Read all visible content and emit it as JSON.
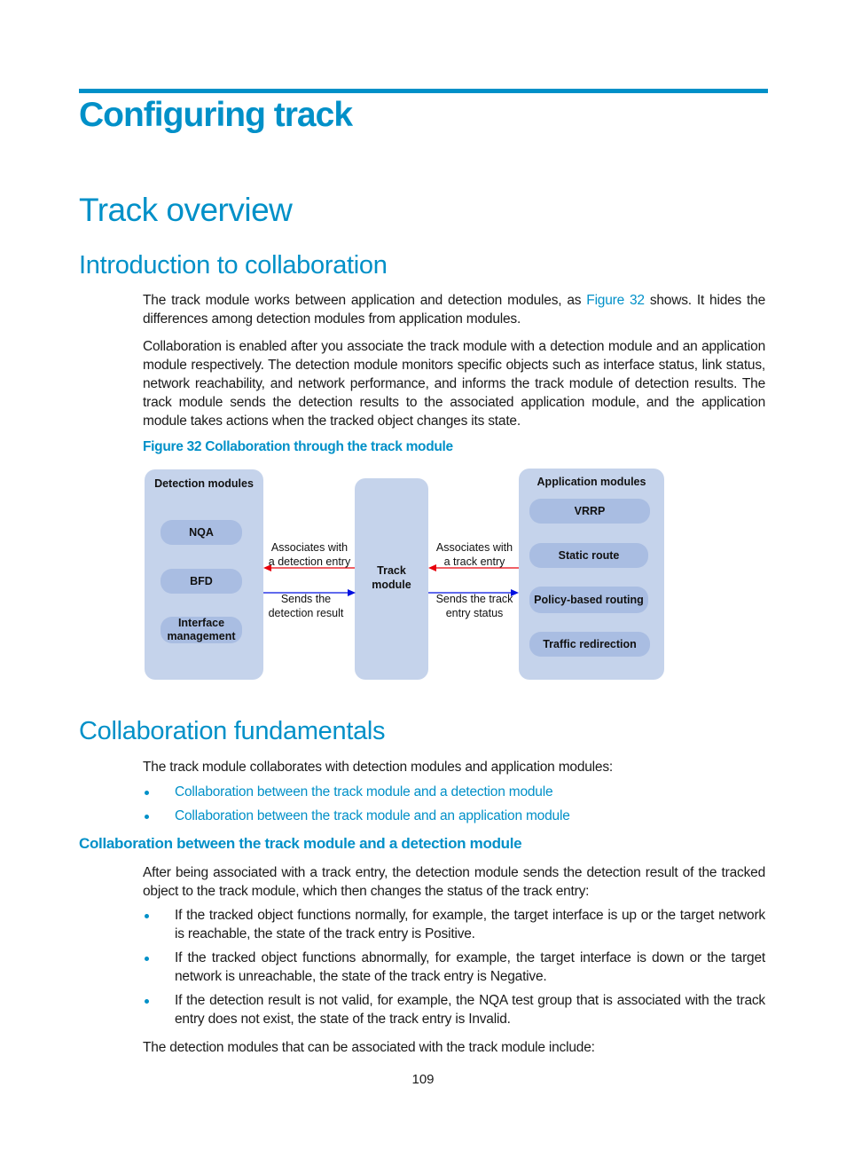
{
  "chapter_title": "Configuring track",
  "section_title": "Track overview",
  "intro": {
    "heading": "Introduction to collaboration",
    "para1_before": "The track module works between application and detection modules, as ",
    "para1_link": "Figure 32",
    "para1_after": " shows. It hides the differences among detection modules from application modules.",
    "para2": "Collaboration is enabled after you associate the track module with a detection module and an application module respectively. The detection module monitors specific objects such as interface status, link status, network reachability, and network performance, and informs the track module of detection results. The track module sends the detection results to the associated application module, and the application module takes actions when the tracked object changes its state."
  },
  "figure": {
    "caption": "Figure 32 Collaboration through the track module",
    "detection_panel": {
      "title": "Detection modules",
      "items": [
        "NQA",
        "BFD",
        "Interface management"
      ]
    },
    "track_panel": {
      "label_line1": "Track",
      "label_line2": "module"
    },
    "application_panel": {
      "title": "Application modules",
      "items": [
        "VRRP",
        "Static route",
        "Policy-based routing",
        "Traffic redirection"
      ]
    },
    "left_arrows": {
      "top_line1": "Associates with",
      "top_line2": "a detection entry",
      "bottom_line1": "Sends the",
      "bottom_line2": "detection result"
    },
    "right_arrows": {
      "top_line1": "Associates with",
      "top_line2": "a track entry",
      "bottom_line1": "Sends the track",
      "bottom_line2": "entry status"
    },
    "colors": {
      "request_arrow": "#e8000b",
      "response_arrow": "#0010e0",
      "panel": "#c5d3eb",
      "pill": "#a9bde2"
    }
  },
  "fundamentals": {
    "heading": "Collaboration fundamentals",
    "intro": "The track module collaborates with detection modules and application modules:",
    "links": [
      "Collaboration between the track module and a detection module",
      "Collaboration between the track module and an application module"
    ]
  },
  "detection_collab": {
    "heading": "Collaboration between the track module and a detection module",
    "intro": "After being associated with a track entry, the detection module sends the detection result of the tracked object to the track module, which then changes the status of the track entry:",
    "bullets": [
      "If the tracked object functions normally, for example, the target interface is up or the target network is reachable, the state of the track entry is Positive.",
      "If the tracked object functions abnormally, for example, the target interface is down or the target network is unreachable, the state of the track entry is Negative.",
      "If the detection result is not valid, for example, the NQA test group that is associated with the track entry does not exist, the state of the track entry is Invalid."
    ],
    "outro": "The detection modules that can be associated with the track module include:"
  },
  "page_number": "109",
  "accent_color": "#0090c8"
}
